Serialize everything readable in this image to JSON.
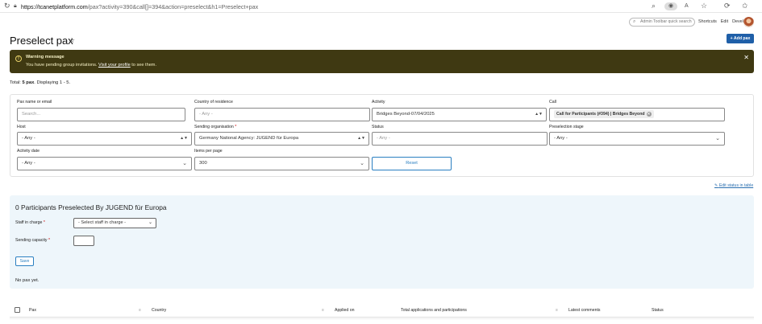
{
  "browser": {
    "url_domain": "https://tcanetplatform.com",
    "url_rest": "/pax?activity=390&call[]=394&action=preselect&h1=Preselect+pax"
  },
  "admin": {
    "search_placeholder": "Admin Toolbar quick search",
    "links": [
      "Shortcuts",
      "Edit",
      "Devel"
    ]
  },
  "page": {
    "title": "Preselect pax",
    "add_label": "+ Add pax"
  },
  "warning": {
    "title": "Warning message",
    "message_pre": "You have pending group invitations. ",
    "message_link": "Visit your profile",
    "message_post": " to see them."
  },
  "summary": {
    "prefix": "Total: ",
    "total": "5 pax",
    "suffix": ". Displaying 1 - 5."
  },
  "filters": {
    "pax_name": {
      "label": "Pax name or email",
      "placeholder": "Search..."
    },
    "country": {
      "label": "Country of residence",
      "value": "- Any -"
    },
    "activity": {
      "label": "Activity",
      "value": "Bridges Beyond-07/04/2025"
    },
    "call": {
      "label": "Call",
      "chip": "Call for Participants (#394) | Bridges Beyond"
    },
    "host": {
      "label": "Host",
      "value": "- Any -"
    },
    "sending_org": {
      "label": "Sending organisation",
      "value": "Germany National Agency: JUGEND für Europa"
    },
    "status": {
      "label": "Status",
      "value": "- Any -"
    },
    "preselection": {
      "label": "Preselection stage",
      "value": "- Any -"
    },
    "activity_date": {
      "label": "Activity date",
      "value": "- Any -"
    },
    "items_per_page": {
      "label": "Items per page",
      "value": "300"
    },
    "reset_label": "Reset"
  },
  "edit_status_link": "Edit status in table",
  "preselect_panel": {
    "heading": "0 Participants Preselected By JUGEND für Europa",
    "staff_label": "Staff in charge",
    "staff_value": "- Select staff in charge -",
    "capacity_label": "Sending capacity",
    "save_label": "Save",
    "empty_text": "No pax yet."
  },
  "table": {
    "columns": [
      "Pax",
      "Country",
      "Applied on",
      "Total applications and participations",
      "Latest comments",
      "Status"
    ]
  }
}
